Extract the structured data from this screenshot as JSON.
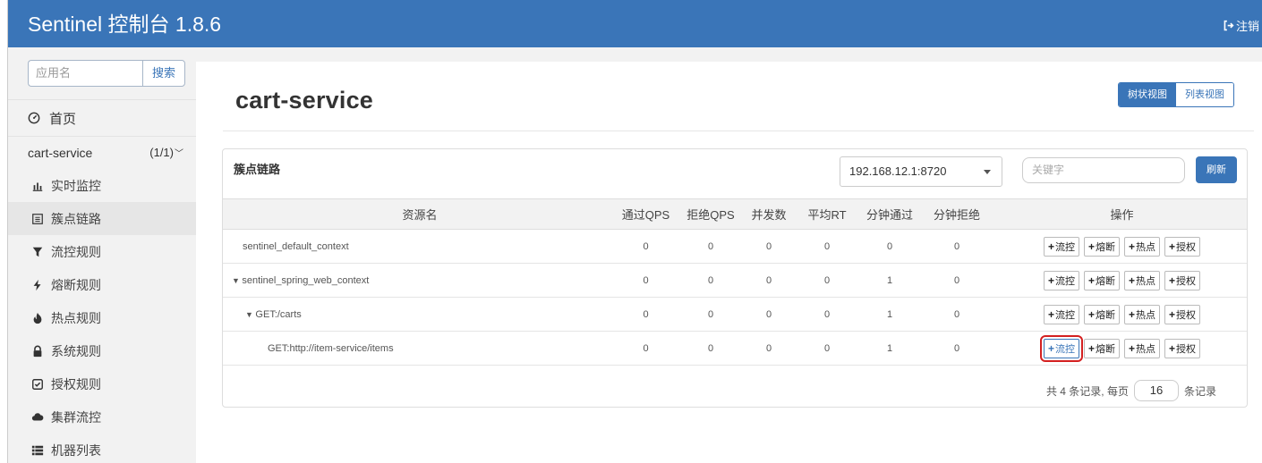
{
  "header": {
    "title": "Sentinel 控制台 1.8.6",
    "logout": "注销"
  },
  "sidebar": {
    "search_placeholder": "应用名",
    "search_button": "搜索",
    "home": "首页",
    "app_name": "cart-service",
    "app_count": "(1/1)",
    "items": [
      {
        "label": "实时监控",
        "icon": "bar-chart-icon"
      },
      {
        "label": "簇点链路",
        "icon": "list-icon",
        "active": true
      },
      {
        "label": "流控规则",
        "icon": "filter-icon"
      },
      {
        "label": "熔断规则",
        "icon": "flash-icon"
      },
      {
        "label": "热点规则",
        "icon": "fire-icon"
      },
      {
        "label": "系统规则",
        "icon": "lock-icon"
      },
      {
        "label": "授权规则",
        "icon": "check-icon"
      },
      {
        "label": "集群流控",
        "icon": "cloud-icon"
      },
      {
        "label": "机器列表",
        "icon": "th-list-icon"
      }
    ]
  },
  "main": {
    "title": "cart-service",
    "view_tree": "树状视图",
    "view_list": "列表视图",
    "panel_title": "簇点链路",
    "machine": "192.168.12.1:8720",
    "keyword_placeholder": "关键字",
    "refresh": "刷新",
    "columns": [
      "资源名",
      "通过QPS",
      "拒绝QPS",
      "并发数",
      "平均RT",
      "分钟通过",
      "分钟拒绝",
      "操作"
    ],
    "rows": [
      {
        "resource": "sentinel_default_context",
        "prefix": "",
        "pass_qps": "0",
        "block_qps": "0",
        "concurrency": "0",
        "avg_rt": "0",
        "min_pass": "0",
        "min_block": "0"
      },
      {
        "resource": "sentinel_spring_web_context",
        "prefix": "▼ ",
        "pass_qps": "0",
        "block_qps": "0",
        "concurrency": "0",
        "avg_rt": "0",
        "min_pass": "1",
        "min_block": "0"
      },
      {
        "resource": "GET:/carts",
        "prefix": "▼ ",
        "pass_qps": "0",
        "block_qps": "0",
        "concurrency": "0",
        "avg_rt": "0",
        "min_pass": "1",
        "min_block": "0"
      },
      {
        "resource": "GET:http://item-service/items",
        "prefix": "",
        "pass_qps": "0",
        "block_qps": "0",
        "concurrency": "0",
        "avg_rt": "0",
        "min_pass": "1",
        "min_block": "0"
      }
    ],
    "actions": {
      "flow": "流控",
      "degrade": "熔断",
      "hotspot": "热点",
      "auth": "授权"
    },
    "pager": {
      "prefix": "共 4 条记录, 每页",
      "page_size": "16",
      "suffix": "条记录"
    },
    "highlight_color": "#d42020"
  }
}
